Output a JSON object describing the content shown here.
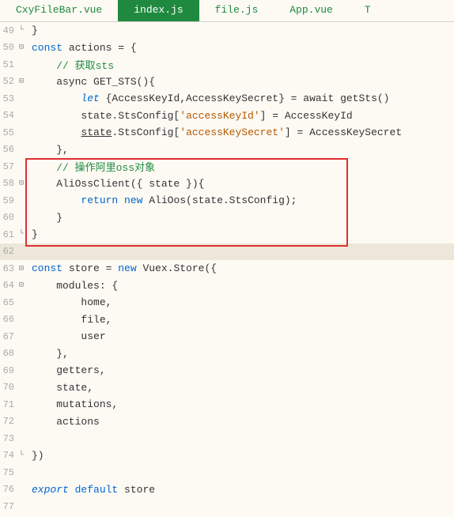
{
  "tabs": [
    {
      "label": "CxyFileBar.vue",
      "active": false
    },
    {
      "label": "index.js",
      "active": true
    },
    {
      "label": "file.js",
      "active": false
    },
    {
      "label": "App.vue",
      "active": false
    },
    {
      "label": "T",
      "active": false
    }
  ],
  "lines": [
    {
      "num": "49",
      "fold": "└",
      "parts": [
        {
          "t": "}",
          "c": "nm"
        }
      ]
    },
    {
      "num": "50",
      "fold": "⊟",
      "parts": [
        {
          "t": "const",
          "c": "kw"
        },
        {
          "t": " actions = {",
          "c": "nm"
        }
      ]
    },
    {
      "num": "51",
      "fold": "",
      "parts": [
        {
          "t": "    ",
          "c": ""
        },
        {
          "t": "// 获取sts",
          "c": "com"
        }
      ]
    },
    {
      "num": "52",
      "fold": "⊟",
      "parts": [
        {
          "t": "    async GET_STS(){",
          "c": "nm"
        }
      ]
    },
    {
      "num": "53",
      "fold": "",
      "parts": [
        {
          "t": "        ",
          "c": ""
        },
        {
          "t": "let",
          "c": "kw ital"
        },
        {
          "t": " {AccessKeyId,AccessKeySecret} = await getSts()",
          "c": "nm"
        }
      ]
    },
    {
      "num": "54",
      "fold": "",
      "parts": [
        {
          "t": "        state.StsConfig[",
          "c": "nm"
        },
        {
          "t": "'accessKeyId'",
          "c": "str"
        },
        {
          "t": "] = AccessKeyId",
          "c": "nm"
        }
      ]
    },
    {
      "num": "55",
      "fold": "",
      "parts": [
        {
          "t": "        ",
          "c": ""
        },
        {
          "t": "state",
          "c": "nm under"
        },
        {
          "t": ".StsConfig[",
          "c": "nm"
        },
        {
          "t": "'accessKeySecret'",
          "c": "str"
        },
        {
          "t": "] = AccessKeySecret",
          "c": "nm"
        }
      ]
    },
    {
      "num": "56",
      "fold": "",
      "parts": [
        {
          "t": "    },",
          "c": "nm"
        }
      ]
    },
    {
      "num": "57",
      "fold": "",
      "parts": [
        {
          "t": "    ",
          "c": ""
        },
        {
          "t": "// 操作阿里oss对象",
          "c": "com"
        }
      ]
    },
    {
      "num": "58",
      "fold": "⊟",
      "parts": [
        {
          "t": "    AliOssClient({ state }){",
          "c": "nm"
        }
      ]
    },
    {
      "num": "59",
      "fold": "",
      "parts": [
        {
          "t": "        ",
          "c": ""
        },
        {
          "t": "return",
          "c": "kw"
        },
        {
          "t": " ",
          "c": ""
        },
        {
          "t": "new",
          "c": "kw"
        },
        {
          "t": " AliOos(state.StsConfig);",
          "c": "nm"
        }
      ]
    },
    {
      "num": "60",
      "fold": "",
      "parts": [
        {
          "t": "    }",
          "c": "nm"
        }
      ]
    },
    {
      "num": "61",
      "fold": "└",
      "parts": [
        {
          "t": "}",
          "c": "nm"
        }
      ]
    },
    {
      "num": "62",
      "fold": "",
      "hl": true,
      "parts": [
        {
          "t": "",
          "c": ""
        }
      ]
    },
    {
      "num": "63",
      "fold": "⊟",
      "parts": [
        {
          "t": "const",
          "c": "kw"
        },
        {
          "t": " store = ",
          "c": "nm"
        },
        {
          "t": "new",
          "c": "kw"
        },
        {
          "t": " Vuex.Store({",
          "c": "nm"
        }
      ]
    },
    {
      "num": "64",
      "fold": "⊟",
      "parts": [
        {
          "t": "    modules: {",
          "c": "nm"
        }
      ]
    },
    {
      "num": "65",
      "fold": "",
      "parts": [
        {
          "t": "        home,",
          "c": "nm"
        }
      ]
    },
    {
      "num": "66",
      "fold": "",
      "parts": [
        {
          "t": "        file,",
          "c": "nm"
        }
      ]
    },
    {
      "num": "67",
      "fold": "",
      "parts": [
        {
          "t": "        user",
          "c": "nm"
        }
      ]
    },
    {
      "num": "68",
      "fold": "",
      "parts": [
        {
          "t": "    },",
          "c": "nm"
        }
      ]
    },
    {
      "num": "69",
      "fold": "",
      "parts": [
        {
          "t": "    getters,",
          "c": "nm"
        }
      ]
    },
    {
      "num": "70",
      "fold": "",
      "parts": [
        {
          "t": "    state,",
          "c": "nm"
        }
      ]
    },
    {
      "num": "71",
      "fold": "",
      "parts": [
        {
          "t": "    mutations,",
          "c": "nm"
        }
      ]
    },
    {
      "num": "72",
      "fold": "",
      "parts": [
        {
          "t": "    actions",
          "c": "nm"
        }
      ]
    },
    {
      "num": "73",
      "fold": "",
      "parts": [
        {
          "t": "",
          "c": ""
        }
      ]
    },
    {
      "num": "74",
      "fold": "└",
      "parts": [
        {
          "t": "})",
          "c": "nm"
        }
      ]
    },
    {
      "num": "75",
      "fold": "",
      "parts": [
        {
          "t": "",
          "c": ""
        }
      ]
    },
    {
      "num": "76",
      "fold": "",
      "parts": [
        {
          "t": "export",
          "c": "kw ital"
        },
        {
          "t": " ",
          "c": ""
        },
        {
          "t": "default",
          "c": "kw"
        },
        {
          "t": " store",
          "c": "nm"
        }
      ]
    },
    {
      "num": "77",
      "fold": "",
      "parts": [
        {
          "t": "",
          "c": ""
        }
      ]
    }
  ]
}
